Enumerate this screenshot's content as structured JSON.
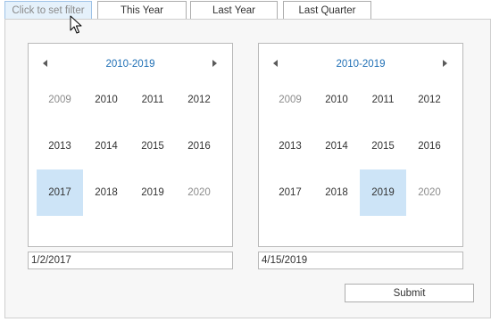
{
  "tabs": [
    {
      "label": "Click to set filter"
    },
    {
      "label": "This Year"
    },
    {
      "label": "Last Year"
    },
    {
      "label": "Last Quarter"
    }
  ],
  "calendars": [
    {
      "range": "2010-2019",
      "years": [
        {
          "label": "2009",
          "out": true
        },
        {
          "label": "2010"
        },
        {
          "label": "2011"
        },
        {
          "label": "2012"
        },
        {
          "label": "2013"
        },
        {
          "label": "2014"
        },
        {
          "label": "2015"
        },
        {
          "label": "2016"
        },
        {
          "label": "2017",
          "selected": true
        },
        {
          "label": "2018"
        },
        {
          "label": "2019"
        },
        {
          "label": "2020",
          "out": true
        }
      ],
      "date_value": "1/2/2017"
    },
    {
      "range": "2010-2019",
      "years": [
        {
          "label": "2009",
          "out": true
        },
        {
          "label": "2010"
        },
        {
          "label": "2011"
        },
        {
          "label": "2012"
        },
        {
          "label": "2013"
        },
        {
          "label": "2014"
        },
        {
          "label": "2015"
        },
        {
          "label": "2016"
        },
        {
          "label": "2017"
        },
        {
          "label": "2018"
        },
        {
          "label": "2019",
          "selected": true
        },
        {
          "label": "2020",
          "out": true
        }
      ],
      "date_value": "4/15/2019"
    }
  ],
  "submit_label": "Submit",
  "icons": {
    "prev": "chevron-left-icon",
    "next": "chevron-right-icon",
    "cursor": "mouse-pointer-icon"
  },
  "colors": {
    "accent": "#1f6fb5",
    "selected": "#cde4f7",
    "active_tab": "#e5f1fb"
  }
}
